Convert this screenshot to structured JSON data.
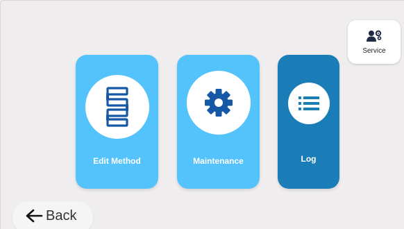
{
  "service": {
    "label": "Service",
    "icon": "user-gear-icon"
  },
  "tiles": [
    {
      "label": "Edit Method",
      "icon": "flowchart-icon",
      "color": "#54c2fb"
    },
    {
      "label": "Maintenance",
      "icon": "gear-icon",
      "color": "#54c2fb"
    },
    {
      "label": "Log",
      "icon": "list-icon",
      "color": "#1a7db7"
    }
  ],
  "back": {
    "label": "Back",
    "icon": "arrow-left-icon"
  },
  "colors": {
    "background": "#efedee",
    "icon_blue": "#1558a6",
    "dark_icon": "#1f2a44"
  }
}
